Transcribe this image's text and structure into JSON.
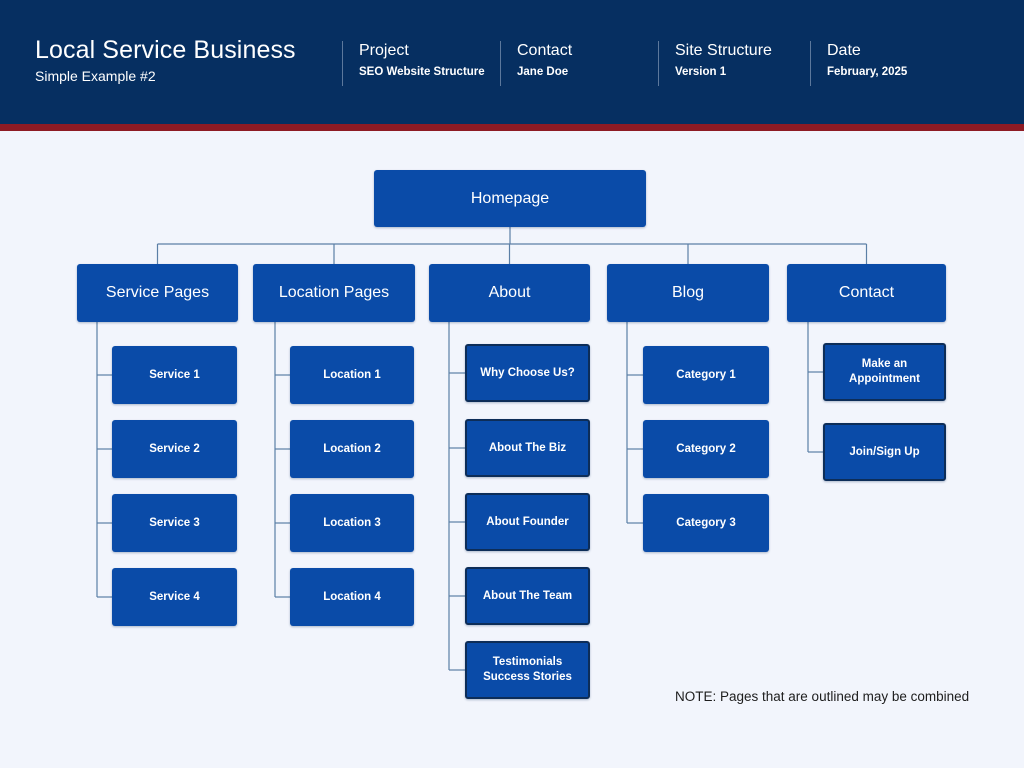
{
  "header": {
    "title": "Local Service Business",
    "subtitle": "Simple Example #2",
    "meta": [
      {
        "label": "Project",
        "value": "SEO Website Structure"
      },
      {
        "label": "Contact",
        "value": "Jane Doe"
      },
      {
        "label": "Site Structure",
        "value": "Version 1"
      },
      {
        "label": "Date",
        "value": "February, 2025"
      }
    ],
    "colors": {
      "background": "#062f61",
      "accent_bar": "#8e1b24",
      "text": "#ffffff"
    }
  },
  "diagram": {
    "type": "site-structure-tree",
    "colors": {
      "page_background": "#f2f5fc",
      "node_fill": "#0a4ba8",
      "node_outline": "#0d2d58",
      "connector": "#5b7fa6",
      "node_text": "#ffffff"
    },
    "root": {
      "label": "Homepage"
    },
    "branches": [
      {
        "label": "Service Pages",
        "children": [
          {
            "label": "Service 1",
            "outlined": false
          },
          {
            "label": "Service 2",
            "outlined": false
          },
          {
            "label": "Service 3",
            "outlined": false
          },
          {
            "label": "Service 4",
            "outlined": false
          }
        ]
      },
      {
        "label": "Location Pages",
        "children": [
          {
            "label": "Location 1",
            "outlined": false
          },
          {
            "label": "Location 2",
            "outlined": false
          },
          {
            "label": "Location 3",
            "outlined": false
          },
          {
            "label": "Location 4",
            "outlined": false
          }
        ]
      },
      {
        "label": "About",
        "children": [
          {
            "label": "Why Choose Us?",
            "outlined": true
          },
          {
            "label": "About The Biz",
            "outlined": true
          },
          {
            "label": "About Founder",
            "outlined": true
          },
          {
            "label": "About The Team",
            "outlined": true
          },
          {
            "label": "Testimonials\nSuccess Stories",
            "outlined": true
          }
        ]
      },
      {
        "label": "Blog",
        "children": [
          {
            "label": "Category 1",
            "outlined": false
          },
          {
            "label": "Category 2",
            "outlined": false
          },
          {
            "label": "Category 3",
            "outlined": false
          }
        ]
      },
      {
        "label": "Contact",
        "children": [
          {
            "label": "Make an\nAppointment",
            "outlined": true
          },
          {
            "label": "Join/Sign Up",
            "outlined": true
          }
        ]
      }
    ]
  },
  "note": "NOTE: Pages that are outlined may be combined"
}
